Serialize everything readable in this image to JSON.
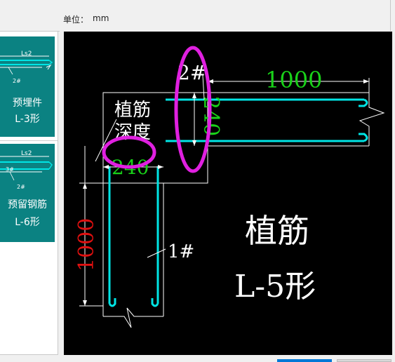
{
  "header": {
    "unit_label": "单位：",
    "unit_value": "mm"
  },
  "sidebar": {
    "cards": [
      {
        "label_line1": "预埋件",
        "label_line2": "L-3形",
        "thumb_texts": [
          "Ls2",
          "2#"
        ]
      },
      {
        "label_line1": "预留钢筋",
        "label_line2": "L-6形",
        "thumb_texts": [
          "Ls2",
          "3#",
          "2#"
        ]
      }
    ]
  },
  "drawing": {
    "title_line1": "植筋",
    "title_line2": "L-5形",
    "embed_label_line1": "植筋",
    "embed_label_line2": "深度",
    "bar1_label": "1#",
    "bar2_label": "2#",
    "dim_top_length": "1000",
    "dim_vertical_depth": "240",
    "dim_horizontal_depth": "240",
    "dim_left_length": "1000",
    "colors": {
      "rebar": "#00e5e5",
      "dim_green": "#19d219",
      "dim_red": "#e01010",
      "highlight": "#e020e0",
      "outline": "#ffffff",
      "background": "#000000"
    }
  }
}
